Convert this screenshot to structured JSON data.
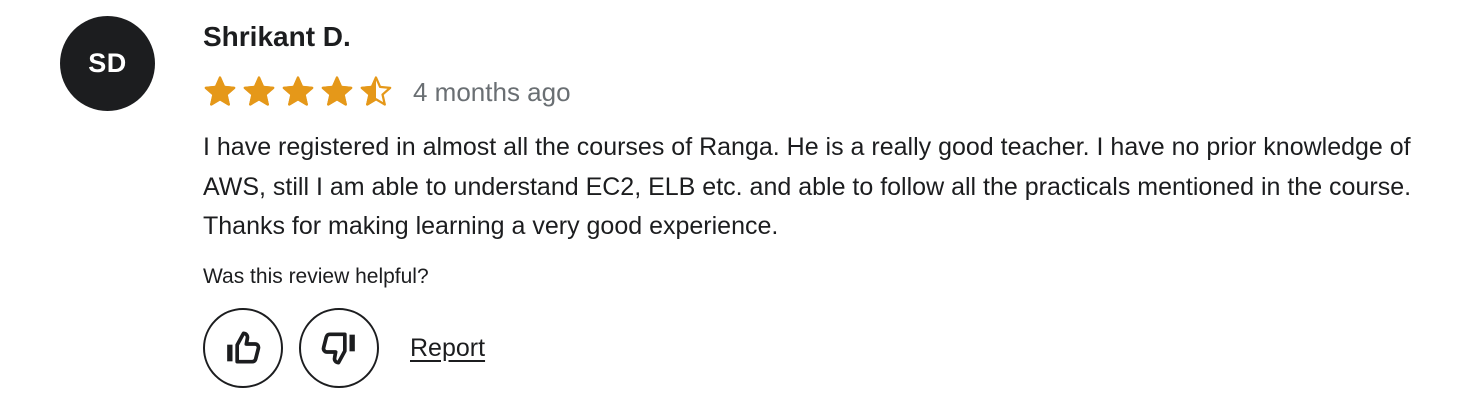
{
  "review": {
    "avatar_initials": "SD",
    "reviewer_name": "Shrikant D.",
    "rating": 4.5,
    "rating_max": 5,
    "star_color": "#e59819",
    "time_ago": "4 months ago",
    "text": "I have registered in almost all the courses of Ranga. He is a really good teacher. I have no prior knowledge of AWS, still I am able to understand EC2, ELB etc. and able to follow all the practicals mentioned in the course. Thanks for making learning a very good experience.",
    "helpful_prompt": "Was this review helpful?",
    "actions": {
      "thumbs_up_icon": "thumbs-up-icon",
      "thumbs_down_icon": "thumbs-down-icon",
      "report_label": "Report"
    }
  }
}
